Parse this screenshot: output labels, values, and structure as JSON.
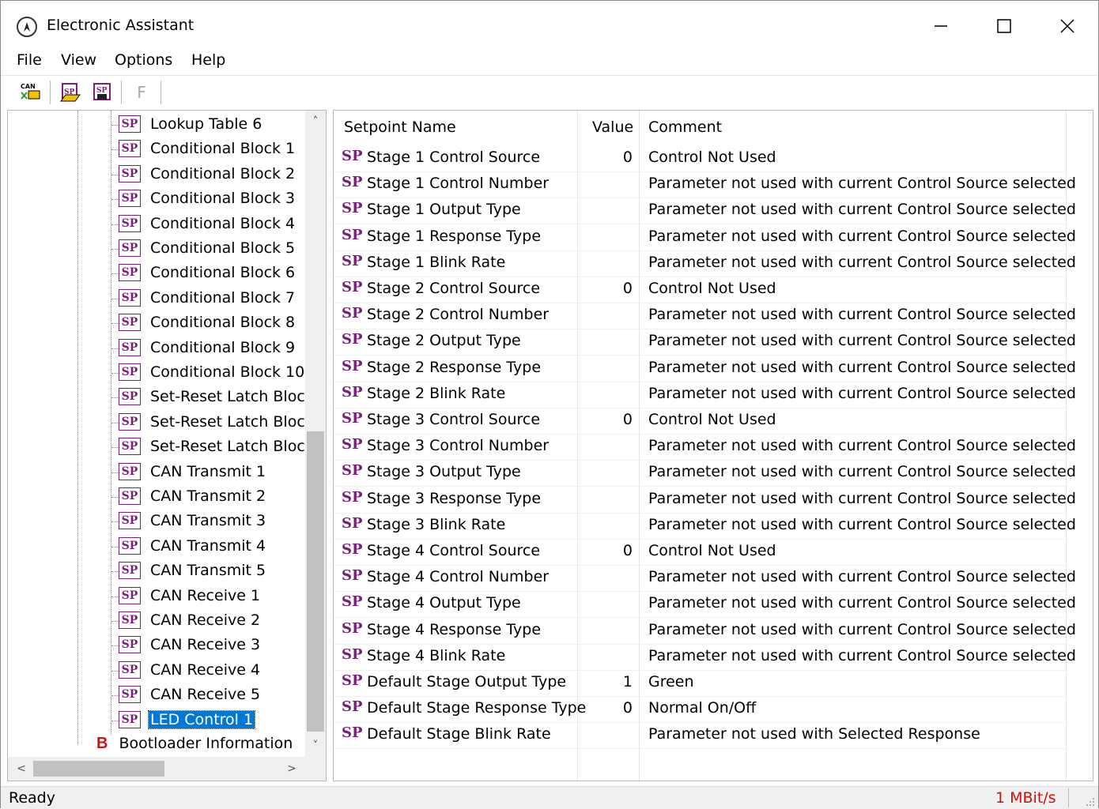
{
  "window": {
    "title": "Electronic Assistant"
  },
  "menu": [
    "File",
    "View",
    "Options",
    "Help"
  ],
  "toolbar": {
    "f_label": "F"
  },
  "tree": {
    "items": [
      "Lookup Table 6",
      "Conditional Block 1",
      "Conditional Block 2",
      "Conditional Block 3",
      "Conditional Block 4",
      "Conditional Block 5",
      "Conditional Block 6",
      "Conditional Block 7",
      "Conditional Block 8",
      "Conditional Block 9",
      "Conditional Block 10",
      "Set-Reset Latch Block",
      "Set-Reset Latch Block",
      "Set-Reset Latch Block",
      "CAN Transmit 1",
      "CAN Transmit 2",
      "CAN Transmit 3",
      "CAN Transmit 4",
      "CAN Transmit 5",
      "CAN Receive 1",
      "CAN Receive 2",
      "CAN Receive 3",
      "CAN Receive 4",
      "CAN Receive 5",
      "LED Control 1"
    ],
    "selected_index": 24,
    "sp_glyph": "SP",
    "bootloader": {
      "glyph": "B",
      "label": "Bootloader Information"
    }
  },
  "grid": {
    "headers": {
      "name": "Setpoint Name",
      "value": "Value",
      "comment": "Comment"
    },
    "sp_glyph": "SP",
    "rows": [
      {
        "name": "Stage 1 Control Source",
        "value": "0",
        "comment": "Control Not Used"
      },
      {
        "name": "Stage 1 Control Number",
        "value": "",
        "comment": "Parameter not used with current Control Source selected"
      },
      {
        "name": "Stage 1 Output Type",
        "value": "",
        "comment": "Parameter not used with current Control Source selected"
      },
      {
        "name": "Stage 1 Response Type",
        "value": "",
        "comment": "Parameter not used with current Control Source selected"
      },
      {
        "name": "Stage 1 Blink Rate",
        "value": "",
        "comment": "Parameter not used with current Control Source selected"
      },
      {
        "name": "Stage 2 Control Source",
        "value": "0",
        "comment": "Control Not Used"
      },
      {
        "name": "Stage 2 Control Number",
        "value": "",
        "comment": "Parameter not used with current Control Source selected"
      },
      {
        "name": "Stage 2 Output Type",
        "value": "",
        "comment": "Parameter not used with current Control Source selected"
      },
      {
        "name": "Stage 2 Response Type",
        "value": "",
        "comment": "Parameter not used with current Control Source selected"
      },
      {
        "name": "Stage 2 Blink Rate",
        "value": "",
        "comment": "Parameter not used with current Control Source selected"
      },
      {
        "name": "Stage 3 Control Source",
        "value": "0",
        "comment": "Control Not Used"
      },
      {
        "name": "Stage 3 Control Number",
        "value": "",
        "comment": "Parameter not used with current Control Source selected"
      },
      {
        "name": "Stage 3 Output Type",
        "value": "",
        "comment": "Parameter not used with current Control Source selected"
      },
      {
        "name": "Stage 3 Response Type",
        "value": "",
        "comment": "Parameter not used with current Control Source selected"
      },
      {
        "name": "Stage 3 Blink Rate",
        "value": "",
        "comment": "Parameter not used with current Control Source selected"
      },
      {
        "name": "Stage 4 Control Source",
        "value": "0",
        "comment": "Control Not Used"
      },
      {
        "name": "Stage 4 Control Number",
        "value": "",
        "comment": "Parameter not used with current Control Source selected"
      },
      {
        "name": "Stage 4 Output Type",
        "value": "",
        "comment": "Parameter not used with current Control Source selected"
      },
      {
        "name": "Stage 4 Response Type",
        "value": "",
        "comment": "Parameter not used with current Control Source selected"
      },
      {
        "name": "Stage 4 Blink Rate",
        "value": "",
        "comment": "Parameter not used with current Control Source selected"
      },
      {
        "name": "Default Stage Output Type",
        "value": "1",
        "comment": "Green"
      },
      {
        "name": "Default Stage Response Type",
        "value": "0",
        "comment": "Normal On/Off"
      },
      {
        "name": "Default Stage Blink Rate",
        "value": "",
        "comment": "Parameter not used with Selected Response"
      }
    ]
  },
  "status": {
    "left": "Ready",
    "right": "1 MBit/s"
  },
  "colors": {
    "selection": "#0078d7",
    "sp_icon": "#7a1e7a",
    "bootloader": "#cc1111",
    "baud": "#cc1111"
  }
}
